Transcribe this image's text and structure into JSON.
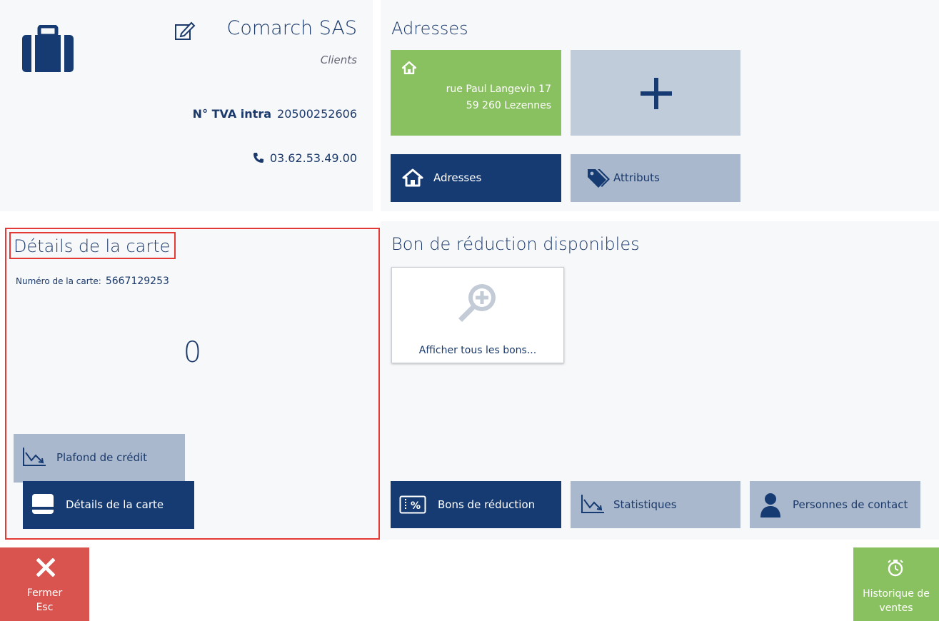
{
  "customer": {
    "name": "Comarch SAS",
    "category": "Clients",
    "vat_label": "N° TVA intra",
    "vat_value": "20500252606",
    "phone": "03.62.53.49.00"
  },
  "addresses": {
    "title": "Adresses",
    "address_line1": "rue Paul Langevin 17",
    "address_line2": "59 260 Lezennes",
    "buttons": {
      "addresses": "Adresses",
      "attributes": "Attributs"
    }
  },
  "card": {
    "title": "Détails de la carte",
    "number_label": "Numéro de la carte:",
    "number_value": "5667129253",
    "points": "0",
    "buttons": {
      "credit_limit": "Plafond de crédit",
      "card_details": "Détails de la carte"
    }
  },
  "vouchers": {
    "title": "Bon de réduction disponibles",
    "show_all": "Afficher tous les bons...",
    "buttons": {
      "vouchers": "Bons de réduction",
      "statistics": "Statistiques",
      "contacts": "Personnes de contact"
    }
  },
  "footer": {
    "close_label": "Fermer",
    "close_shortcut": "Esc",
    "history_label_line1": "Historique de",
    "history_label_line2": "ventes"
  },
  "colors": {
    "navy": "#163b73",
    "slate": "#a9b8cc",
    "green": "#8ac160",
    "red": "#d9534f",
    "highlight": "#e53935"
  }
}
